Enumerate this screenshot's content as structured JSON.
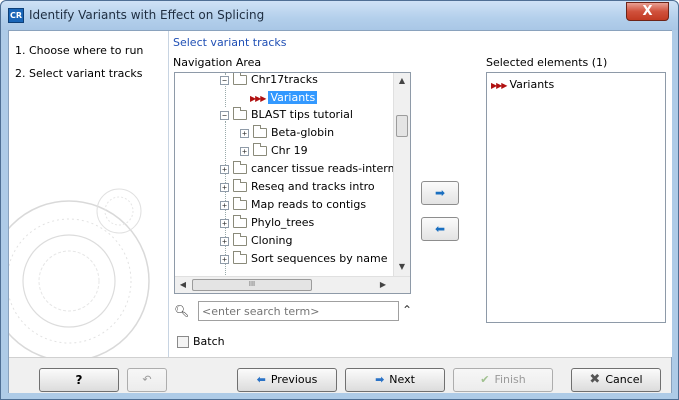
{
  "window": {
    "title": "Identify Variants with Effect on Splicing",
    "app_icon": "CR",
    "close_glyph": "X"
  },
  "steps": [
    {
      "number": "1.",
      "label": "Choose where to run"
    },
    {
      "number": "2.",
      "label": "Select variant tracks"
    }
  ],
  "content": {
    "section_title": "Select variant tracks",
    "navigation_label": "Navigation Area",
    "selected_label": "Selected elements (1)"
  },
  "tree": {
    "items": [
      {
        "label": "Chr17tracks",
        "expander": "−"
      },
      {
        "label": "Variants"
      },
      {
        "label": "BLAST tips tutorial",
        "expander": "−"
      },
      {
        "label": "Beta-globin",
        "expander": "+"
      },
      {
        "label": "Chr 19",
        "expander": "+"
      },
      {
        "label": "cancer tissue reads-intermec",
        "expander": "+"
      },
      {
        "label": "Reseq and tracks intro",
        "expander": "+"
      },
      {
        "label": "Map reads to contigs",
        "expander": "+"
      },
      {
        "label": "Phylo_trees",
        "expander": "+"
      },
      {
        "label": "Cloning",
        "expander": "+"
      },
      {
        "label": "Sort sequences by name",
        "expander": "+"
      }
    ],
    "hscroll_thumb": "III"
  },
  "search": {
    "placeholder": "<enter search term>"
  },
  "selected_elements": [
    {
      "label": "Variants"
    }
  ],
  "batch": {
    "label": "Batch",
    "checked": false
  },
  "footer": {
    "help": "?",
    "previous": "Previous",
    "next": "Next",
    "finish": "Finish",
    "cancel": "Cancel"
  },
  "colors": {
    "accent": "#1f4fb5",
    "selection": "#3399ff",
    "track_icon": "#b01010"
  }
}
